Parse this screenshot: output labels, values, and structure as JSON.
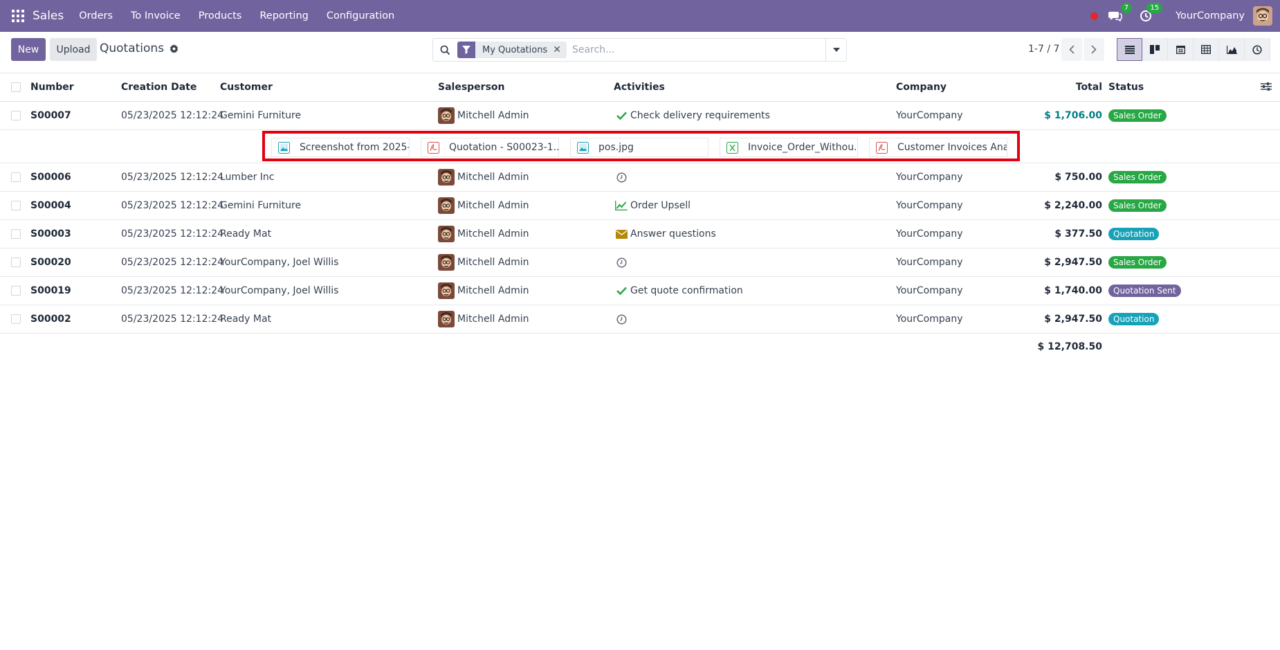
{
  "navbar": {
    "app_name": "Sales",
    "menu": [
      "Orders",
      "To Invoice",
      "Products",
      "Reporting",
      "Configuration"
    ],
    "messages_count": "7",
    "activities_count": "15",
    "company": "YourCompany",
    "accent_color": "#71639e"
  },
  "control_panel": {
    "new_label": "New",
    "upload_label": "Upload",
    "title": "Quotations",
    "search": {
      "facet_label": "My Quotations",
      "placeholder": "Search..."
    },
    "pager": "1-7 / 7",
    "views": [
      "list-icon",
      "kanban-icon",
      "calendar-icon",
      "pivot-icon",
      "graph-icon",
      "activity-icon"
    ]
  },
  "table": {
    "headers": {
      "number": "Number",
      "creation_date": "Creation Date",
      "customer": "Customer",
      "salesperson": "Salesperson",
      "activities": "Activities",
      "company": "Company",
      "total": "Total",
      "status": "Status"
    },
    "rows": [
      {
        "number": "S00007",
        "date": "05/23/2025 12:12:24",
        "customer": "Gemini Furniture",
        "salesperson": "Mitchell Admin",
        "activity_icon": "check-icon",
        "activity": "Check delivery requirements",
        "company": "YourCompany",
        "total": "$ 1,706.00",
        "status": "Sales Order",
        "status_color": "#28a745"
      },
      {
        "number": "S00006",
        "date": "05/23/2025 12:12:24",
        "customer": "Lumber Inc",
        "salesperson": "Mitchell Admin",
        "activity_icon": "clock-icon",
        "activity": "",
        "company": "YourCompany",
        "total": "$ 750.00",
        "status": "Sales Order",
        "status_color": "#28a745"
      },
      {
        "number": "S00004",
        "date": "05/23/2025 12:12:24",
        "customer": "Gemini Furniture",
        "salesperson": "Mitchell Admin",
        "activity_icon": "chart-line-icon",
        "activity": "Order Upsell",
        "company": "YourCompany",
        "total": "$ 2,240.00",
        "status": "Sales Order",
        "status_color": "#28a745"
      },
      {
        "number": "S00003",
        "date": "05/23/2025 12:12:24",
        "customer": "Ready Mat",
        "salesperson": "Mitchell Admin",
        "activity_icon": "envelope-icon",
        "activity": "Answer questions",
        "company": "YourCompany",
        "total": "$ 377.50",
        "status": "Quotation",
        "status_color": "#17a2b8"
      },
      {
        "number": "S00020",
        "date": "05/23/2025 12:12:24",
        "customer": "YourCompany, Joel Willis",
        "salesperson": "Mitchell Admin",
        "activity_icon": "clock-icon",
        "activity": "",
        "company": "YourCompany",
        "total": "$ 2,947.50",
        "status": "Sales Order",
        "status_color": "#28a745"
      },
      {
        "number": "S00019",
        "date": "05/23/2025 12:12:24",
        "customer": "YourCompany, Joel Willis",
        "salesperson": "Mitchell Admin",
        "activity_icon": "check-icon",
        "activity": "Get quote confirmation",
        "company": "YourCompany",
        "total": "$ 1,740.00",
        "status": "Quotation Sent",
        "status_color": "#71639e"
      },
      {
        "number": "S00002",
        "date": "05/23/2025 12:12:24",
        "customer": "Ready Mat",
        "salesperson": "Mitchell Admin",
        "activity_icon": "clock-icon",
        "activity": "",
        "company": "YourCompany",
        "total": "$ 2,947.50",
        "status": "Quotation",
        "status_color": "#17a2b8"
      }
    ],
    "attachments": [
      {
        "name": "Screenshot from 2025-...",
        "icon": "image-file-icon"
      },
      {
        "name": "Quotation - S00023-1....",
        "icon": "pdf-file-icon"
      },
      {
        "name": "pos.jpg",
        "icon": "image-file-icon"
      },
      {
        "name": "Invoice_Order_Withou...",
        "icon": "excel-file-icon"
      },
      {
        "name": "Customer Invoices Ana...",
        "icon": "pdf-file-icon"
      }
    ],
    "sum_total": "$ 12,708.50"
  }
}
